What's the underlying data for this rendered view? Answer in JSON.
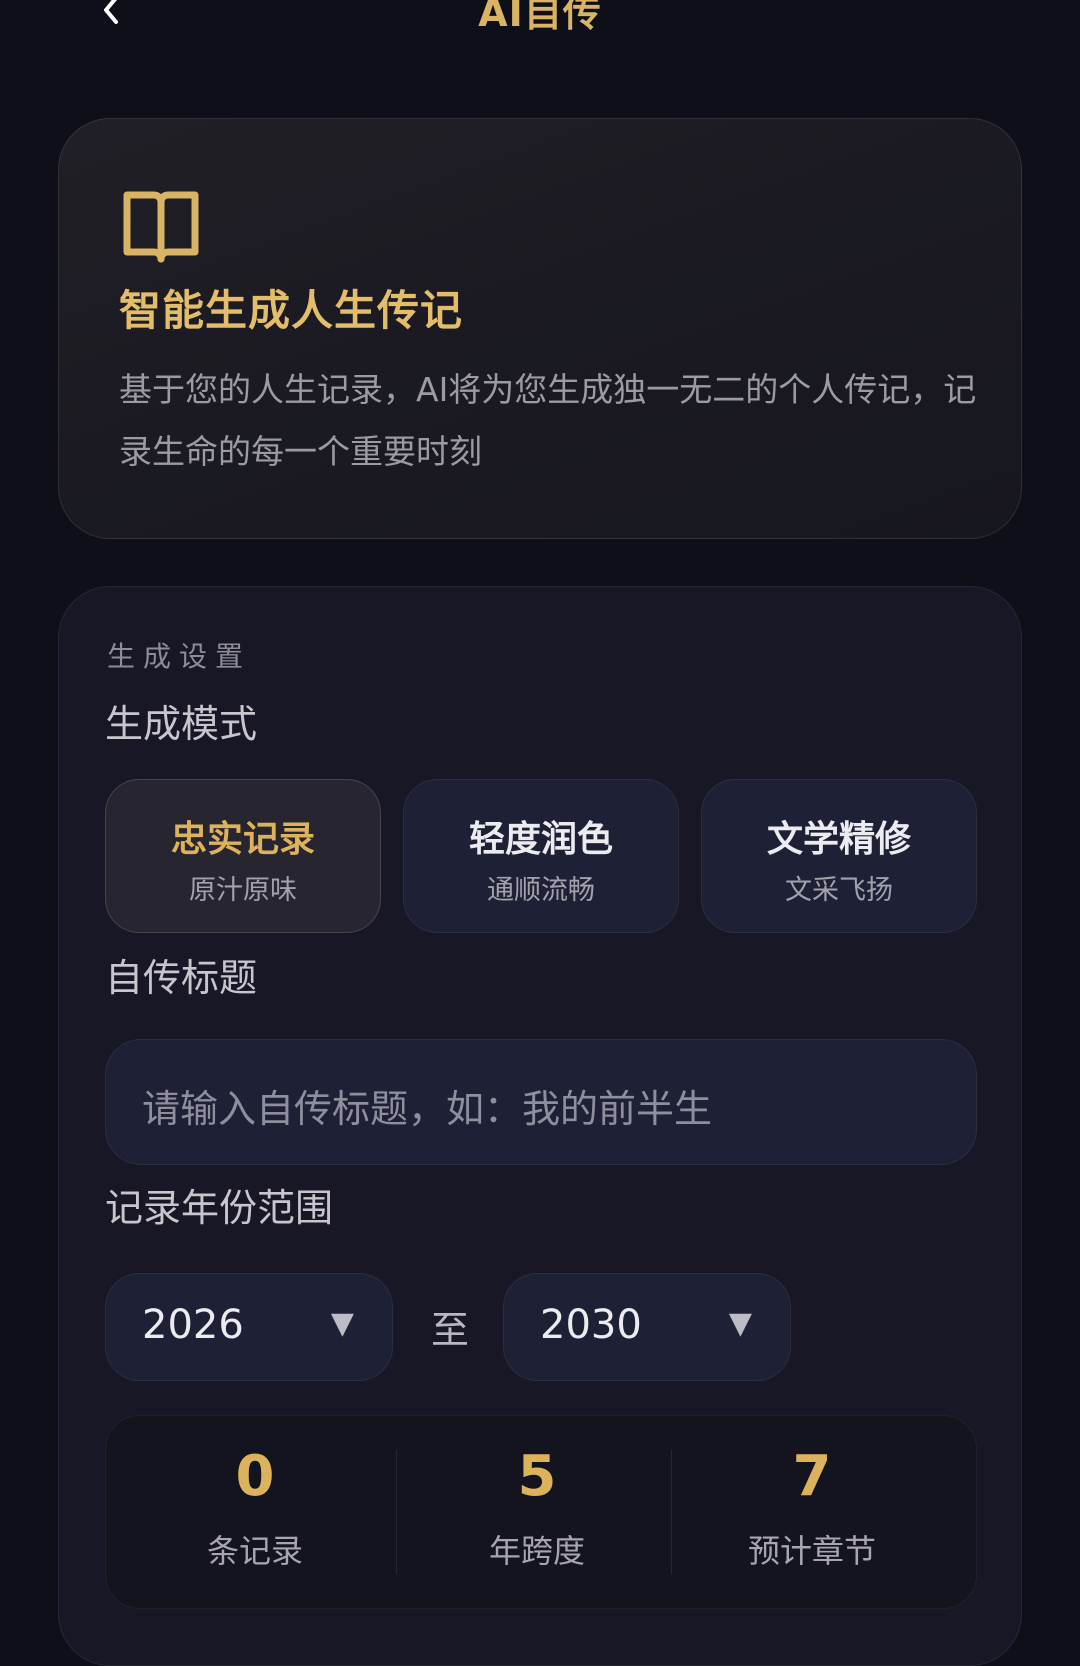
{
  "header": {
    "title": "AI自传"
  },
  "hero": {
    "icon": "book-icon",
    "heading": "智能生成人生传记",
    "description": "基于您的人生记录，AI将为您生成独一无二的个人传记，记录生命的每一个重要时刻"
  },
  "settings": {
    "section_label": "生成设置",
    "mode_label": "生成模式",
    "modes": [
      {
        "title": "忠实记录",
        "subtitle": "原汁原味",
        "selected": true
      },
      {
        "title": "轻度润色",
        "subtitle": "通顺流畅",
        "selected": false
      },
      {
        "title": "文学精修",
        "subtitle": "文采飞扬",
        "selected": false
      }
    ],
    "title_label": "自传标题",
    "title_input": {
      "value": "",
      "placeholder": "请输入自传标题，如：我的前半生"
    },
    "year_label": "记录年份范围",
    "year_from": "2026",
    "year_to": "2030",
    "year_separator": "至",
    "dropdown_arrow": "▼"
  },
  "stats": [
    {
      "value": "0",
      "label": "条记录"
    },
    {
      "value": "5",
      "label": "年跨度"
    },
    {
      "value": "7",
      "label": "预计章节"
    }
  ],
  "colors": {
    "accent": "#dcb25c",
    "background": "#0f0f1a",
    "card": "#1e2036"
  }
}
